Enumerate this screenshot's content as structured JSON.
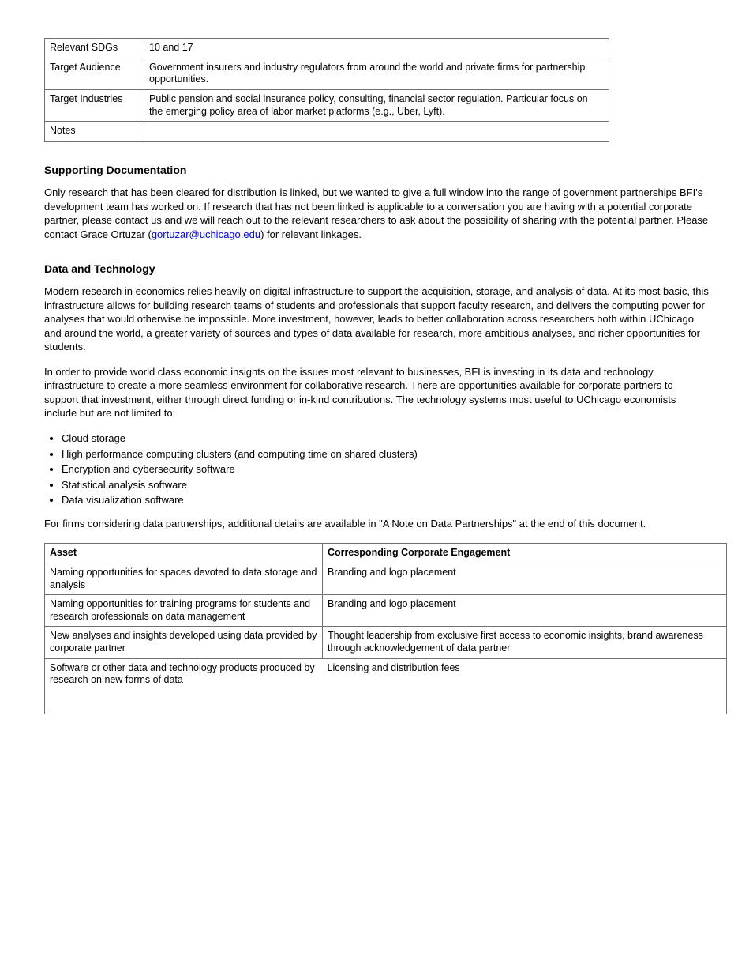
{
  "table1": {
    "rows": [
      {
        "col1": "Relevant SDGs",
        "col2": "10 and 17"
      },
      {
        "col1": "Target Audience",
        "col2": "Government insurers and industry regulators from around the world and private firms for partnership opportunities."
      },
      {
        "col1": "Target Industries",
        "col2": "Public pension and social insurance policy, consulting, financial sector regulation. Particular focus on the emerging policy area of labor market platforms (e.g., Uber, Lyft)."
      },
      {
        "col1": "Notes",
        "col2": ""
      }
    ]
  },
  "section1": {
    "heading": "Supporting Documentation",
    "p1_prefix": "Only research that has been cleared for distribution is linked, but we wanted to give a full window into the range of government partnerships BFI's development team has worked on. If research that has not been linked is applicable to a conversation you are having with a potential corporate partner, please contact us and we will reach out to the relevant researchers to ask about the possibility of sharing with the potential partner. Please contact Grace Ortuzar (",
    "email": "gortuzar@uchicago.edu",
    "p1_suffix": ") for relevant linkages."
  },
  "section2": {
    "heading": "Data and Technology",
    "p1": "Modern research in economics relies heavily on digital infrastructure to support the acquisition, storage, and analysis of data. At its most basic, this infrastructure allows for building research teams of students and professionals that support faculty research, and delivers the computing power for analyses that would otherwise be impossible. More investment, however, leads to better collaboration across researchers both within UChicago and around the world, a greater variety of sources and types of data available for research, more ambitious analyses, and richer opportunities for students.",
    "p2": "In order to provide world class economic insights on the issues most relevant to businesses, BFI is investing in its data and technology infrastructure to create a more seamless environment for collaborative research. There are opportunities available for corporate partners to support that investment, either through direct funding or in-kind contributions. The technology systems most useful to UChicago economists include but are not limited to:",
    "list": [
      "Cloud storage",
      "High performance computing clusters (and computing time on shared clusters)",
      "Encryption and cybersecurity software",
      "Statistical analysis software",
      "Data visualization software"
    ],
    "p3": "For firms considering data partnerships, additional details are available in \"A Note on Data Partnerships\" at the end of this document."
  },
  "table2": {
    "header": {
      "c1": "Asset",
      "c2": "Corresponding Corporate Engagement"
    },
    "rows": [
      {
        "c1": "Naming opportunities for spaces devoted to data storage and analysis",
        "c2": "Branding and logo placement"
      },
      {
        "c1": "Naming opportunities for training programs for students and research professionals on data management",
        "c2": "Branding and logo placement"
      },
      {
        "c1": "New analyses and insights developed using data provided by corporate partner",
        "c2": "Thought leadership from exclusive first access to economic insights, brand awareness through acknowledgement of data partner"
      },
      {
        "c1": "Software or other data and technology products produced by research on new forms of data",
        "c2": "Licensing and distribution fees"
      }
    ]
  }
}
